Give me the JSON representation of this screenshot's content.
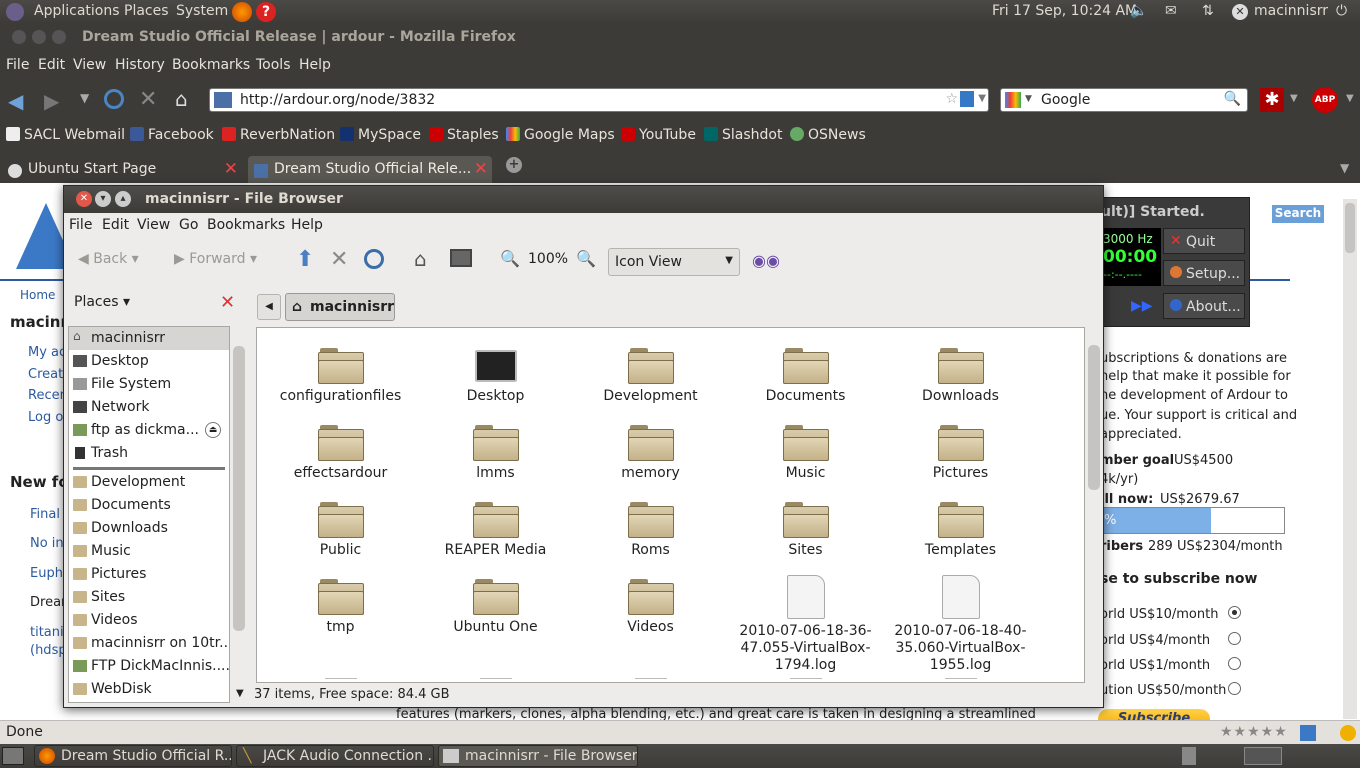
{
  "top_panel": {
    "menus": [
      "Applications",
      "Places",
      "System"
    ],
    "datetime": "Fri 17 Sep, 10:24 AM",
    "user": "macinnisrr"
  },
  "firefox": {
    "title": "Dream Studio Official Release | ardour - Mozilla Firefox",
    "menus": [
      "File",
      "Edit",
      "View",
      "History",
      "Bookmarks",
      "Tools",
      "Help"
    ],
    "url": "http://ardour.org/node/3832",
    "search_engine": "Google",
    "bookmarks": [
      "SACL Webmail",
      "Facebook",
      "ReverbNation",
      "MySpace",
      "Staples",
      "Google Maps",
      "YouTube",
      "Slashdot",
      "OSNews"
    ],
    "tabs": [
      "Ubuntu Start Page",
      "Dream Studio Official Rele..."
    ],
    "status": "Done"
  },
  "page": {
    "breadcrumb": "Home",
    "user_heading": "macinn",
    "user_links": [
      "My ac",
      "Create",
      "Recen",
      "Log ou"
    ],
    "new_forum": "New fo",
    "forum_items": [
      "Final",
      "No in",
      "Euphe",
      "Drean",
      "titani",
      "(hdsp"
    ],
    "search_button": "Search",
    "jack_started": "ult)] Started.",
    "jack_rate": "3000 Hz",
    "jack_time": "00:00",
    "jack_sub": "--:--.----",
    "jack_quit": "Quit",
    "jack_setup": "Setup...",
    "jack_about": "About...",
    "sub_text": [
      "ubscriptions & donations are",
      "help that make it possible for",
      "ne development of Ardour to",
      "ue. Your support is critical and",
      "appreciated."
    ],
    "member_goal_label": "mber goal",
    "member_goal_value": "US$4500",
    "member_goal_sub": "4k/yr)",
    "till_now_label": "ill now:",
    "till_now_value": "US$2679.67",
    "progress_label": "%",
    "progress_fraction": 0.6,
    "subscribers_label": "ribers",
    "subscribers_value": "289 US$2304/month",
    "subscribe_heading": "se to subscribe now",
    "options": [
      "orld US$10/month",
      "orld US$4/month",
      "orld US$1/month",
      "ution US$50/month"
    ],
    "subscribe_button": "Subscribe",
    "footer_text": "features (markers, clones, alpha blending, etc.) and great care is taken in designing a streamlined"
  },
  "file_browser": {
    "title": "macinnisrr - File Browser",
    "menus": [
      "File",
      "Edit",
      "View",
      "Go",
      "Bookmarks",
      "Help"
    ],
    "toolbar": {
      "back": "Back",
      "forward": "Forward",
      "zoom": "100%",
      "view_mode": "Icon View"
    },
    "places_label": "Places",
    "path_button": "macinnisrr",
    "places": [
      "macinnisrr",
      "Desktop",
      "File System",
      "Network",
      "ftp as dickma...",
      "Trash"
    ],
    "bookmarks": [
      "Development",
      "Documents",
      "Downloads",
      "Music",
      "Pictures",
      "Sites",
      "Videos",
      "macinnisrr on 10tr...",
      "FTP DickMacInnis....",
      "WebDisk"
    ],
    "items": [
      {
        "name": "configurationfiles",
        "kind": "folder"
      },
      {
        "name": "Desktop",
        "kind": "desktop"
      },
      {
        "name": "Development",
        "kind": "folder"
      },
      {
        "name": "Documents",
        "kind": "folder"
      },
      {
        "name": "Downloads",
        "kind": "folder"
      },
      {
        "name": "effectsardour",
        "kind": "folder"
      },
      {
        "name": "lmms",
        "kind": "folder"
      },
      {
        "name": "memory",
        "kind": "folder"
      },
      {
        "name": "Music",
        "kind": "folder"
      },
      {
        "name": "Pictures",
        "kind": "folder"
      },
      {
        "name": "Public",
        "kind": "folder"
      },
      {
        "name": "REAPER Media",
        "kind": "folder"
      },
      {
        "name": "Roms",
        "kind": "folder"
      },
      {
        "name": "Sites",
        "kind": "folder"
      },
      {
        "name": "Templates",
        "kind": "folder"
      },
      {
        "name": "tmp",
        "kind": "folder"
      },
      {
        "name": "Ubuntu One",
        "kind": "folder"
      },
      {
        "name": "Videos",
        "kind": "folder"
      },
      {
        "name": "2010-07-06-18-36-47.055-VirtualBox-1794.log",
        "kind": "file"
      },
      {
        "name": "2010-07-06-18-40-35.060-VirtualBox-1955.log",
        "kind": "file"
      }
    ],
    "status": "37 items, Free space: 84.4 GB"
  },
  "taskbar": [
    "Dream Studio Official R...",
    "JACK Audio Connection ...",
    "macinnisrr - File Browser"
  ]
}
